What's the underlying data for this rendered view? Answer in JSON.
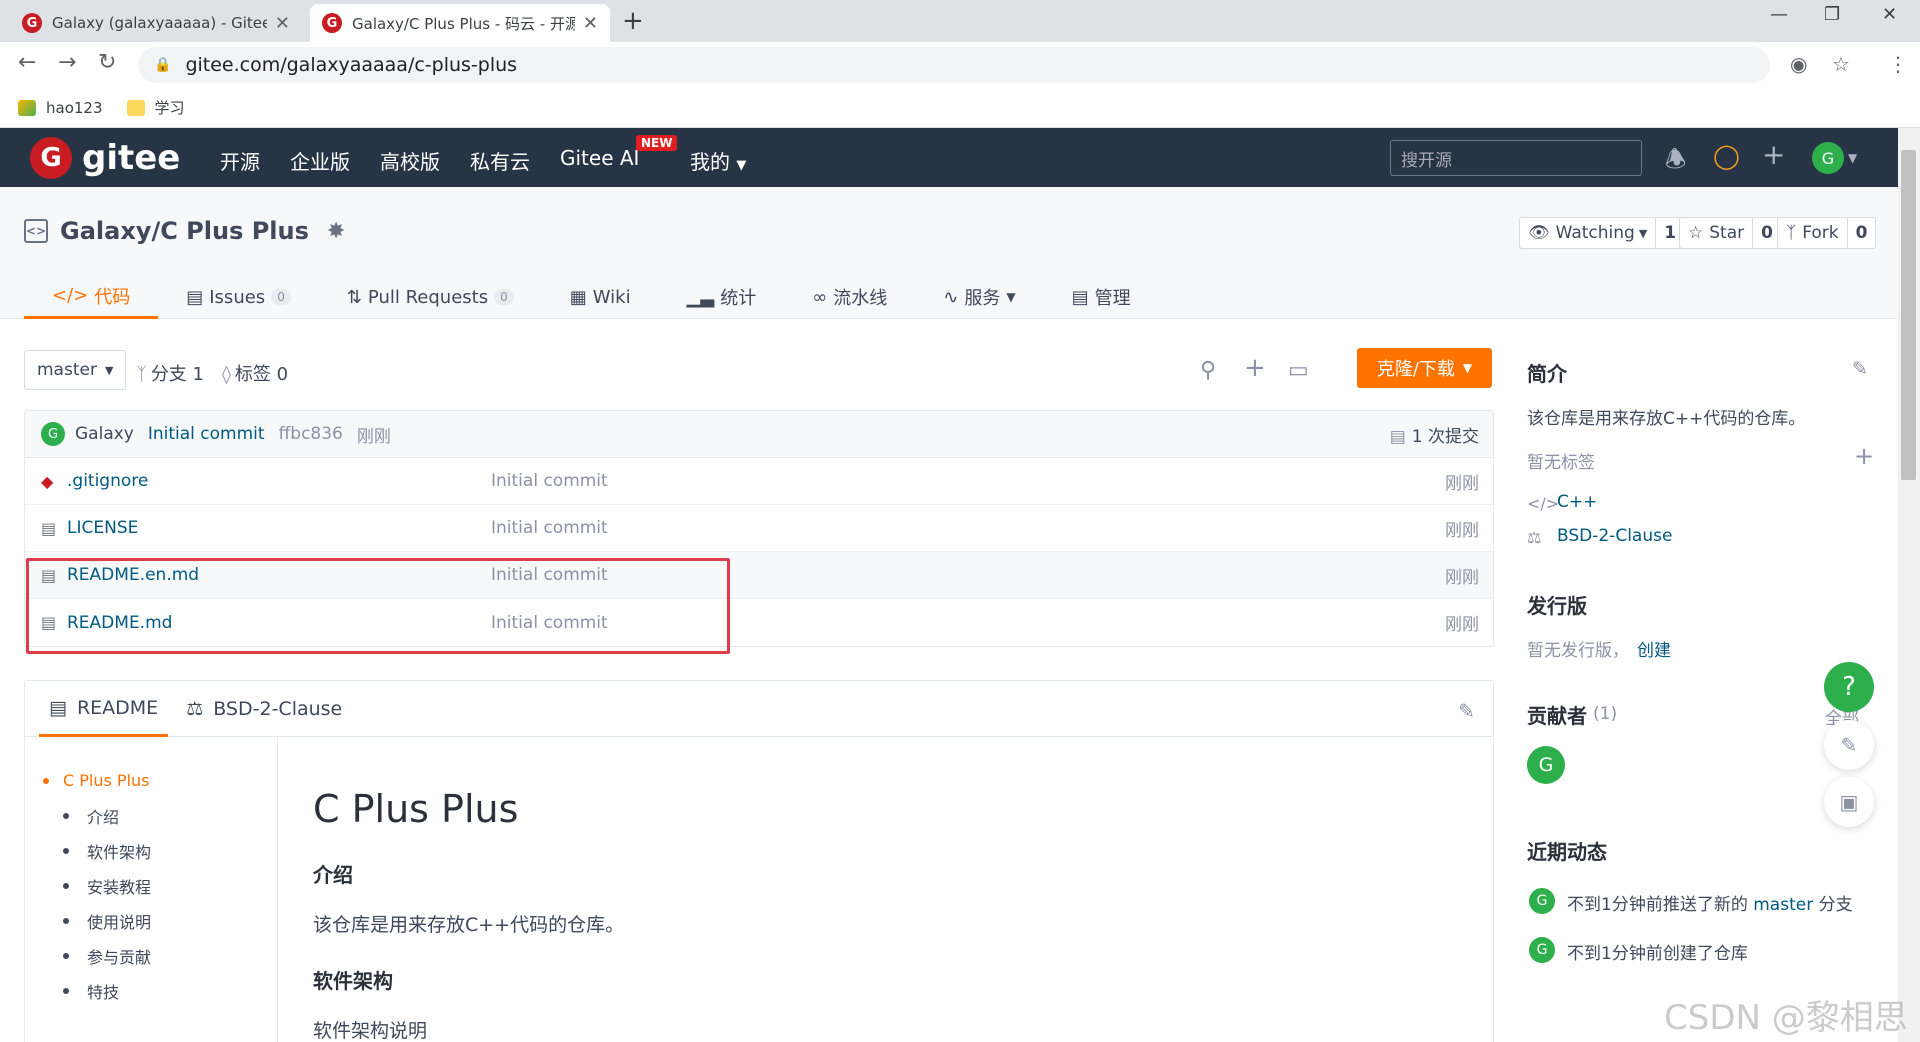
{
  "browser": {
    "tabs": [
      {
        "title": "Galaxy (galaxyaaaaa) - Gitee.c",
        "close": "✕"
      },
      {
        "title": "Galaxy/C Plus Plus - 码云 - 开源",
        "close": "✕"
      }
    ],
    "new_tab": "+",
    "url": "gitee.com/galaxyaaaaa/c-plus-plus",
    "bookmarks": [
      {
        "label": "hao123"
      },
      {
        "label": "学习"
      }
    ]
  },
  "header": {
    "logo_letter": "G",
    "logo_text": "gitee",
    "nav": [
      "开源",
      "企业版",
      "高校版",
      "私有云",
      "Gitee AI",
      "我的"
    ],
    "new_badge": "NEW",
    "search_placeholder": "搜开源",
    "avatar_letter": "G"
  },
  "repo": {
    "title": "Galaxy/C Plus Plus",
    "watching": {
      "label": "Watching",
      "count": "1"
    },
    "star": {
      "label": "Star",
      "count": "0"
    },
    "fork": {
      "label": "Fork",
      "count": "0"
    },
    "tabs": [
      {
        "label": "代码"
      },
      {
        "label": "Issues",
        "badge": "0"
      },
      {
        "label": "Pull Requests",
        "badge": "0"
      },
      {
        "label": "Wiki"
      },
      {
        "label": "统计"
      },
      {
        "label": "流水线"
      },
      {
        "label": "服务"
      },
      {
        "label": "管理"
      }
    ]
  },
  "toolbar": {
    "branch": "master",
    "branches": "分支 1",
    "tags": "标签 0",
    "clone": "克隆/下载"
  },
  "commit": {
    "avatar": "G",
    "author": "Galaxy",
    "message": "Initial commit",
    "hash": "ffbc836",
    "time": "刚刚",
    "count": "1 次提交"
  },
  "files": [
    {
      "name": ".gitignore",
      "message": "Initial commit",
      "time": "刚刚"
    },
    {
      "name": "LICENSE",
      "message": "Initial commit",
      "time": "刚刚"
    },
    {
      "name": "README.en.md",
      "message": "Initial commit",
      "time": "刚刚"
    },
    {
      "name": "README.md",
      "message": "Initial commit",
      "time": "刚刚"
    }
  ],
  "readme": {
    "tabs": [
      "README",
      "BSD-2-Clause"
    ],
    "toc": [
      "C Plus Plus",
      "介绍",
      "软件架构",
      "安装教程",
      "使用说明",
      "参与贡献",
      "特技"
    ],
    "h1": "C Plus Plus",
    "sections": [
      {
        "heading": "介绍",
        "text": "该仓库是用来存放C++代码的仓库。"
      },
      {
        "heading": "软件架构",
        "text": "软件架构说明"
      }
    ]
  },
  "sidebar": {
    "intro_title": "简介",
    "intro_text": "该仓库是用来存放C++代码的仓库。",
    "no_tags": "暂无标签",
    "language": "C++",
    "license": "BSD-2-Clause",
    "release_title": "发行版",
    "no_release": "暂无发行版，",
    "create": "创建",
    "contributors_title": "贡献者",
    "contributors_count": "(1)",
    "contributors_all": "全部",
    "contributor_avatar": "G",
    "activity_title": "近期动态",
    "activities": [
      {
        "avatar": "G",
        "pre": "不到1分钟前推送了新的 ",
        "branch": "master",
        "post": " 分支"
      },
      {
        "avatar": "G",
        "pre": "不到1分钟前创建了仓库",
        "branch": "",
        "post": ""
      }
    ]
  },
  "float": {
    "help": "?"
  },
  "watermark": "CSDN @黎相思",
  "colors": {
    "accent": "#fe7300",
    "header_bg": "#263445",
    "link": "#005980",
    "avatar_green": "#2daf4b",
    "highlight": "#e03d4c"
  }
}
